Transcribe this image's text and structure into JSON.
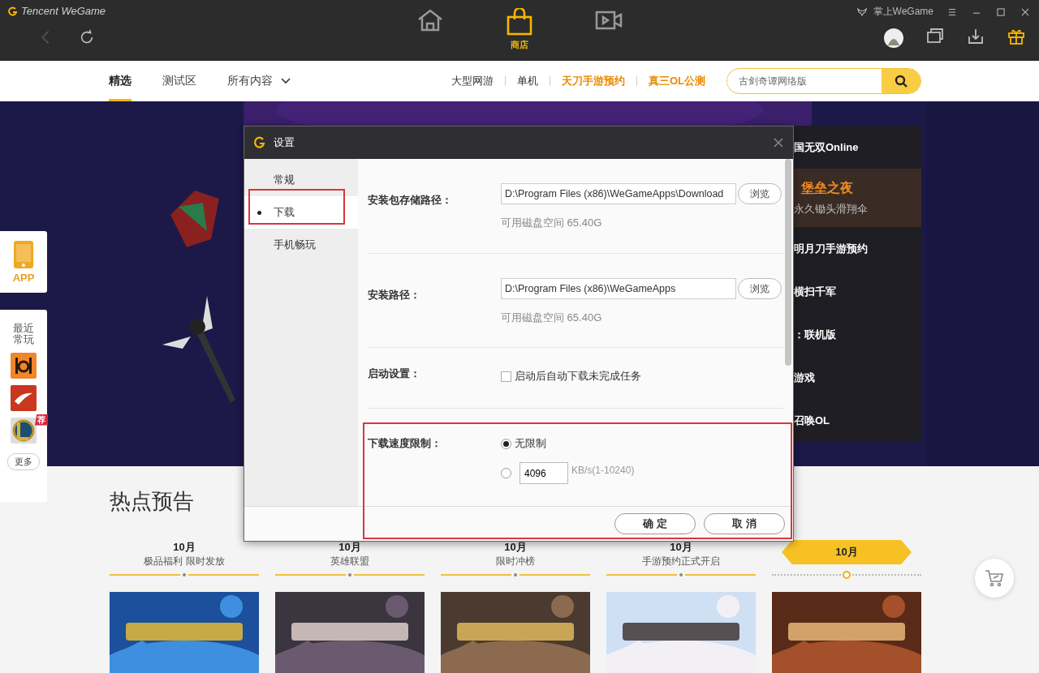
{
  "title_bar": {
    "brand": "Tencent WeGame",
    "mobile_link": "掌上WeGame",
    "nav": [
      {
        "kind": "home",
        "selected": false
      },
      {
        "kind": "shop",
        "label": "商店",
        "selected": true
      },
      {
        "kind": "video",
        "selected": false
      }
    ]
  },
  "tabs": [
    {
      "label": "精选",
      "selected": true
    },
    {
      "label": "测试区",
      "selected": false
    },
    {
      "label": "所有内容",
      "selected": false
    }
  ],
  "quick_links": [
    {
      "label": "大型网游",
      "highlight": false
    },
    {
      "label": "单机",
      "highlight": false
    },
    {
      "label": "天刀手游预约",
      "highlight": true
    },
    {
      "label": "真三OL公测",
      "highlight": true
    }
  ],
  "search": {
    "placeholder": "古剑奇谭网络版"
  },
  "side_panel": {
    "app_label": "APP",
    "recent_title": "最近常玩",
    "recent_games": [
      {
        "kind": "poe"
      },
      {
        "kind": "dnf"
      },
      {
        "kind": "lol",
        "badge": "荐"
      }
    ],
    "more": "更多"
  },
  "banner_list": [
    {
      "title": "国无双Online",
      "selected": false
    },
    {
      "title": "堡垒之夜",
      "subtitle": "永久锄头滑翔伞",
      "selected": true
    },
    {
      "title": "明月刀手游预约",
      "selected": false
    },
    {
      "title": "横扫千军",
      "selected": false
    },
    {
      "title": "：联机版",
      "selected": false
    },
    {
      "title": "游戏",
      "selected": false
    },
    {
      "title": "召唤OL",
      "selected": false
    }
  ],
  "hot_section": {
    "title": "热点预告",
    "timeline": [
      {
        "month": "10月",
        "caption": "极品福利 限时发放",
        "selected": false
      },
      {
        "month": "10月",
        "caption": "英雄联盟",
        "selected": false
      },
      {
        "month": "10月",
        "caption": "限时冲榜",
        "selected": false
      },
      {
        "month": "10月",
        "caption": "手游预约正式开启",
        "selected": false
      },
      {
        "month": "10月",
        "selected": true
      }
    ]
  },
  "settings_dialog": {
    "title": "设置",
    "nav": [
      {
        "label": "常规",
        "selected": false
      },
      {
        "label": "下载",
        "selected": true
      },
      {
        "label": "手机畅玩",
        "selected": false
      }
    ],
    "package_path": {
      "label": "安装包存储路径：",
      "value": "D:\\Program Files (x86)\\WeGameApps\\Download",
      "browse": "浏览",
      "free_space": "可用磁盘空间 65.40G"
    },
    "install_path": {
      "label": "安装路径：",
      "value": "D:\\Program Files (x86)\\WeGameApps",
      "browse": "浏览",
      "free_space": "可用磁盘空间 65.40G"
    },
    "startup": {
      "label": "启动设置：",
      "option": "启动后自动下载未完成任务",
      "checked": false
    },
    "speed_limit": {
      "label": "下载速度限制：",
      "options": [
        {
          "label": "无限制",
          "selected": true
        },
        {
          "value": "4096",
          "unit": "KB/s(1-10240)",
          "selected": false
        }
      ]
    },
    "buttons": [
      "确 定",
      "取 消"
    ]
  }
}
